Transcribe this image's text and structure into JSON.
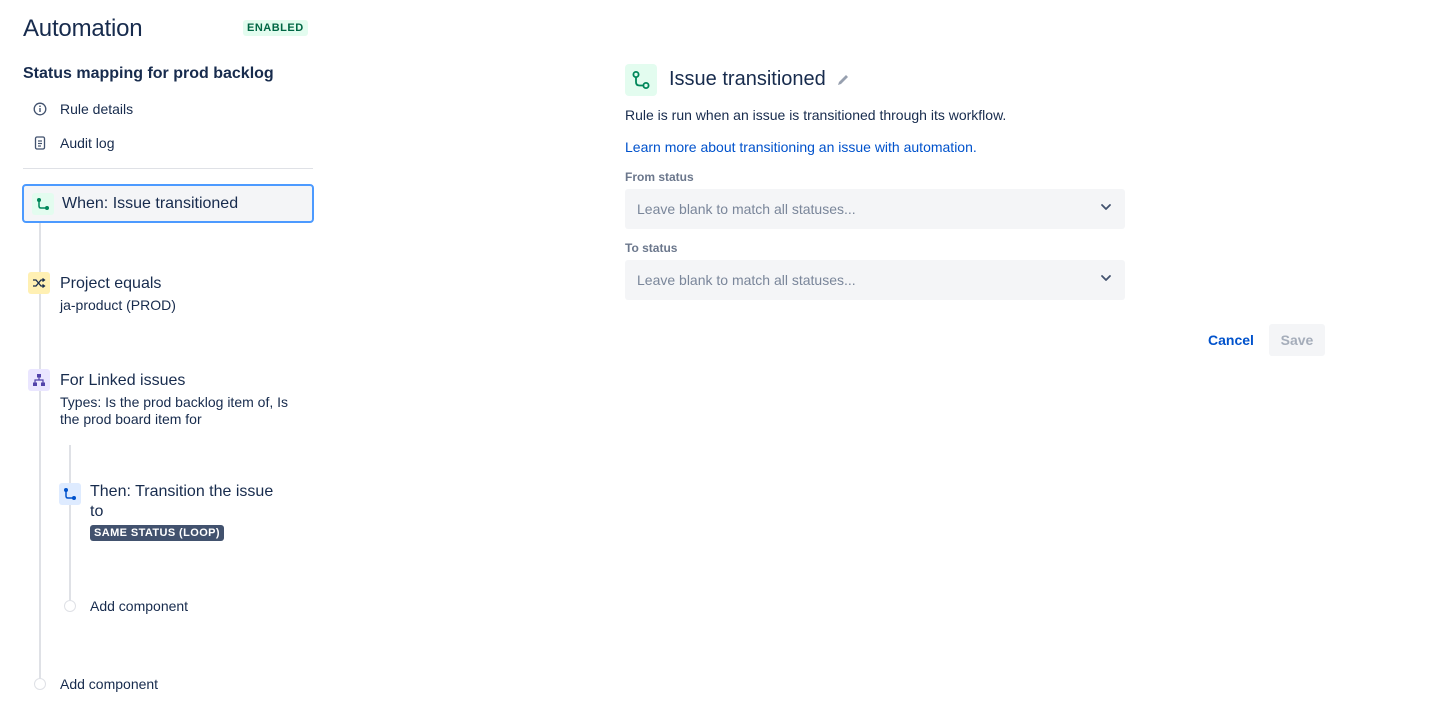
{
  "header": {
    "title": "Automation",
    "status_badge": "ENABLED"
  },
  "rule": {
    "name": "Status mapping for prod backlog"
  },
  "nav": {
    "rule_details": "Rule details",
    "audit_log": "Audit log"
  },
  "timeline": {
    "trigger": {
      "label": "When: Issue transitioned",
      "icon": "transition-icon"
    },
    "condition": {
      "title": "Project equals",
      "subtitle": "ja-product (PROD)",
      "icon": "shuffle-icon"
    },
    "branch": {
      "title": "For Linked issues",
      "subtitle": "Types: Is the prod backlog item of, Is the prod board item for",
      "icon": "hierarchy-icon"
    },
    "action": {
      "title": "Then: Transition the issue to",
      "lozenge": "SAME STATUS (LOOP)",
      "icon": "transition-icon"
    },
    "add_component_inner": "Add component",
    "add_component_outer": "Add component"
  },
  "panel": {
    "title": "Issue transitioned",
    "description": "Rule is run when an issue is transitioned through its workflow.",
    "link": "Learn more about transitioning an issue with automation.",
    "from_status": {
      "label": "From status",
      "placeholder": "Leave blank to match all statuses..."
    },
    "to_status": {
      "label": "To status",
      "placeholder": "Leave blank to match all statuses..."
    },
    "cancel_label": "Cancel",
    "save_label": "Save"
  },
  "colors": {
    "accent_blue": "#0052cc",
    "focus_border": "#4c9aff",
    "enabled_bg": "#e3fcef",
    "enabled_text": "#006644",
    "lozenge_dark": "#42526e"
  }
}
